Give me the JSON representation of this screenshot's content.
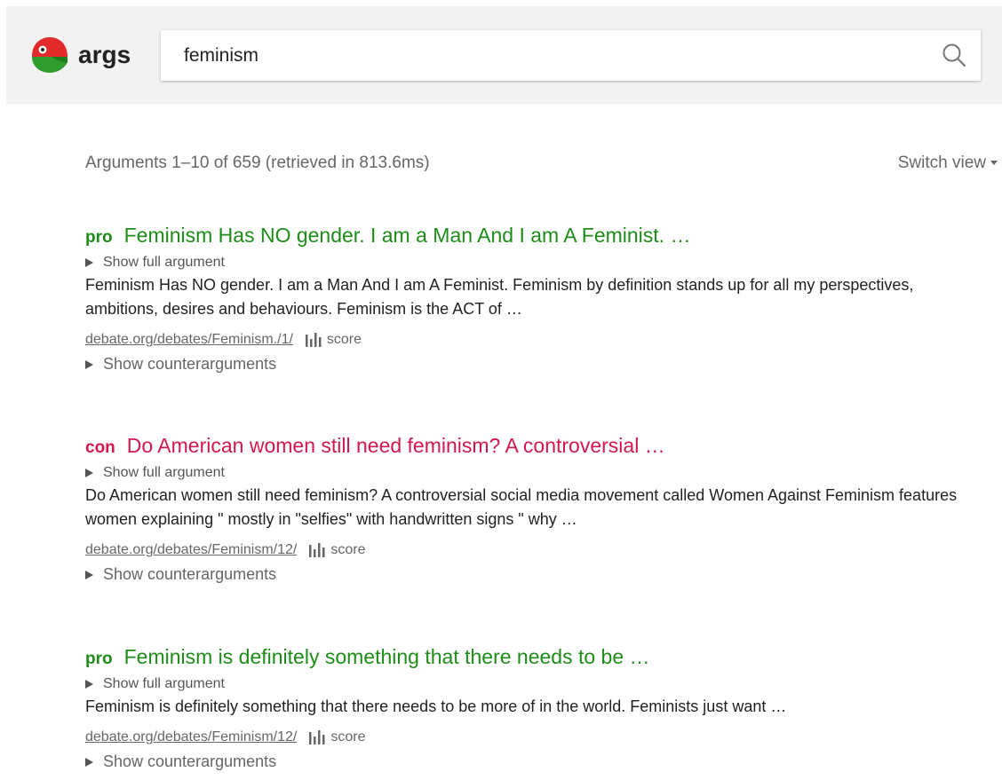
{
  "header": {
    "logo_text": "args",
    "search": {
      "value": "feminism"
    }
  },
  "stats_text": "Arguments 1–10 of 659 (retrieved in 813.6ms)",
  "switch_view_label": "Switch view",
  "results": [
    {
      "stance": "pro",
      "title": "Feminism Has NO gender. I am a Man And I am A Feminist. …",
      "show_full_label": "Show full argument",
      "snippet": "Feminism Has NO gender. I am a Man And I am A Feminist. Feminism by definition stands up for all my perspectives, ambitions, desires and behaviours. Feminism is the ACT of …",
      "source": "debate.org/debates/Feminism./1/",
      "score_label": "score",
      "counter_label": "Show counterarguments"
    },
    {
      "stance": "con",
      "title": "Do American women still need feminism? A controversial …",
      "show_full_label": "Show full argument",
      "snippet": "Do American women still need feminism? A controversial social media movement called Women Against Feminism features women explaining \" mostly in \"selfies\" with handwritten signs \" why …",
      "source": "debate.org/debates/Feminism/12/",
      "score_label": "score",
      "counter_label": "Show counterarguments"
    },
    {
      "stance": "pro",
      "title": "Feminism is definitely something that there needs to be …",
      "show_full_label": "Show full argument",
      "snippet": "Feminism is definitely something that there needs to be more of in the world. Feminists just want …",
      "source": "debate.org/debates/Feminism/12/",
      "score_label": "score",
      "counter_label": "Show counterarguments"
    }
  ],
  "colors": {
    "pro": "#1e8c18",
    "con": "#d3174f",
    "header_bg": "#f2f2f2"
  },
  "icons": {
    "logo": "parrot-logo-icon",
    "search": "search-icon",
    "score": "bar-chart-icon",
    "expand": "triangle-right-icon",
    "dropdown": "caret-down-icon"
  }
}
